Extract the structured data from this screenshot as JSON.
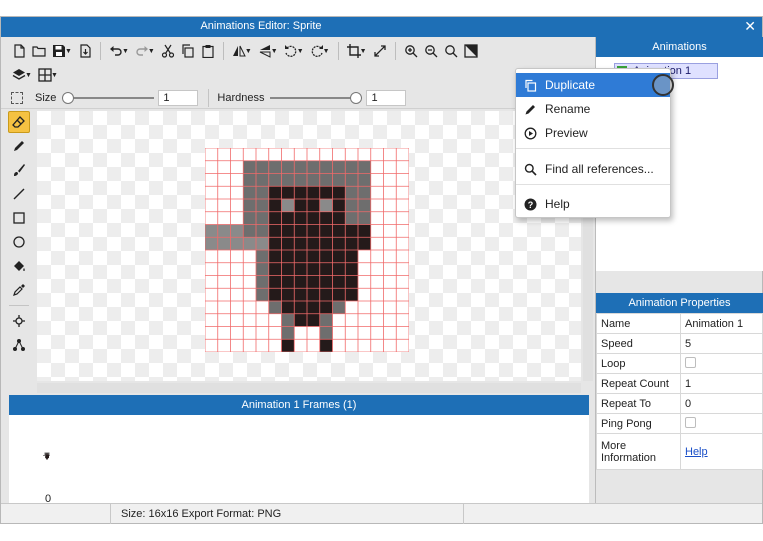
{
  "window": {
    "title": "Animations Editor: Sprite"
  },
  "options": {
    "size_label": "Size",
    "size_value": "1",
    "hardness_label": "Hardness",
    "hardness_value": "1",
    "size_level": 0,
    "hardness_level": 1
  },
  "frames": {
    "title": "Animation 1 Frames (1)",
    "items": [
      {
        "index": "0"
      }
    ]
  },
  "status": {
    "text": "Size: 16x16   Export Format: PNG"
  },
  "animations": {
    "title": "Animations",
    "items": [
      {
        "label": "Animation 1",
        "color": "#3aa33a"
      }
    ]
  },
  "properties": {
    "title": "Animation Properties",
    "rows": [
      {
        "key": "Name",
        "value": "Animation 1",
        "type": "text"
      },
      {
        "key": "Speed",
        "value": "5",
        "type": "text"
      },
      {
        "key": "Loop",
        "value": "",
        "type": "checkbox"
      },
      {
        "key": "Repeat Count",
        "value": "1",
        "type": "text"
      },
      {
        "key": "Repeat To",
        "value": "0",
        "type": "text"
      },
      {
        "key": "Ping Pong",
        "value": "",
        "type": "checkbox"
      },
      {
        "key": "More Information",
        "value": "Help",
        "type": "link"
      }
    ]
  },
  "context_menu": {
    "items": [
      {
        "label": "Duplicate",
        "icon": "duplicate-icon",
        "highlighted": true
      },
      {
        "label": "Rename",
        "icon": "pencil-icon"
      },
      {
        "label": "Preview",
        "icon": "play-icon"
      },
      {
        "label": "Find all references...",
        "icon": "search-icon"
      },
      {
        "label": "Help",
        "icon": "help-icon"
      }
    ]
  },
  "colors": {
    "accent": "#1e6fb6",
    "menu_highlight": "#2f7bd6",
    "grid": "#f06a6a",
    "dark": "#241a1a",
    "mid": "#6e6e6e",
    "light": "#a5a5a5",
    "eye": "#8a8a8a"
  },
  "sprite": {
    "size": 16,
    "rows": [
      "................",
      "...MMMMMMMMMM...",
      "...MMMMMMMMMM...",
      "...MMDDDDDDMM...",
      "...MMDLDDLDMM...",
      "...MMDDDDDDMM...",
      "LLLMMDDDDDDDD...",
      "LLLLLDDDDDDDD...",
      "....MDDDDDDD....",
      "....MDDDDDDD....",
      "....MDDDDDDD....",
      "....MDDDDDDD....",
      ".....MDDDDM.....",
      "......MDDM......",
      "......M..M......",
      "......D..D......"
    ]
  }
}
